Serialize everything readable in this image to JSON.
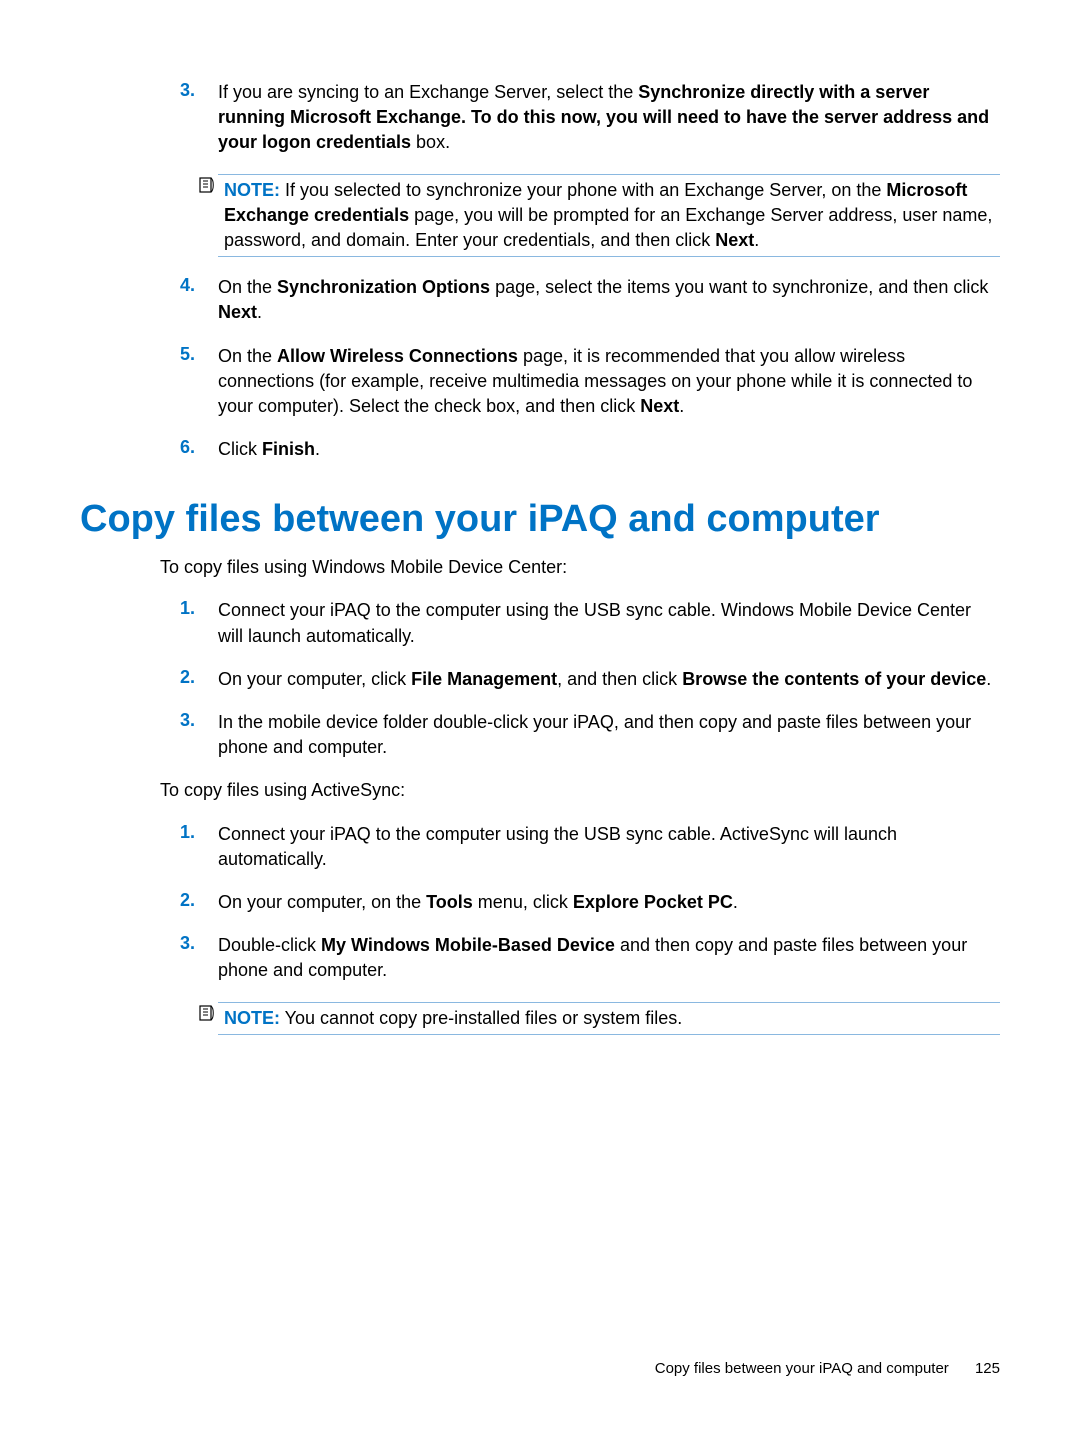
{
  "stepsA": {
    "s3": {
      "num": "3.",
      "t1": "If you are syncing to an Exchange Server, select the ",
      "b1": "Synchronize directly with a server running Microsoft Exchange. To do this now, you will need to have the server address and your logon credentials",
      "t2": " box."
    },
    "note3": {
      "label": "NOTE:",
      "t1": "   If you selected to synchronize your phone with an Exchange Server, on the ",
      "b1": "Microsoft Exchange credentials",
      "t2": " page, you will be prompted for an Exchange Server address, user name, password, and domain. Enter your credentials, and then click ",
      "b2": "Next",
      "t3": "."
    },
    "s4": {
      "num": "4.",
      "t1": "On the ",
      "b1": "Synchronization Options",
      "t2": " page, select the items you want to synchronize, and then click ",
      "b2": "Next",
      "t3": "."
    },
    "s5": {
      "num": "5.",
      "t1": "On the ",
      "b1": "Allow Wireless Connections",
      "t2": " page, it is recommended that you allow wireless connections (for example, receive multimedia messages on your phone while it is connected to your computer). Select the check box, and then click ",
      "b2": "Next",
      "t3": "."
    },
    "s6": {
      "num": "6.",
      "t1": "Click ",
      "b1": "Finish",
      "t2": "."
    }
  },
  "heading": "Copy files between your iPAQ and computer",
  "intro1": "To copy files using Windows Mobile Device Center:",
  "stepsB": {
    "s1": {
      "num": "1.",
      "t1": "Connect your iPAQ to the computer using the USB sync cable. Windows Mobile Device Center will launch automatically."
    },
    "s2": {
      "num": "2.",
      "t1": "On your computer, click ",
      "b1": "File Management",
      "t2": ", and then click ",
      "b2": "Browse the contents of your device",
      "t3": "."
    },
    "s3": {
      "num": "3.",
      "t1": "In the mobile device folder double-click your iPAQ, and then copy and paste files between your phone and computer."
    }
  },
  "intro2": "To copy files using ActiveSync:",
  "stepsC": {
    "s1": {
      "num": "1.",
      "t1": "Connect your iPAQ to the computer using the USB sync cable. ActiveSync will launch automatically."
    },
    "s2": {
      "num": "2.",
      "t1": "On your computer, on the ",
      "b1": "Tools",
      "t2": " menu, click ",
      "b2": "Explore Pocket PC",
      "t3": "."
    },
    "s3": {
      "num": "3.",
      "t1": "Double-click ",
      "b1": "My Windows Mobile-Based Device",
      "t2": " and then copy and paste files between your phone and computer."
    },
    "note": {
      "label": "NOTE:",
      "t1": "   You cannot copy pre-installed files or system files."
    }
  },
  "footer": {
    "text": "Copy files between your iPAQ and computer",
    "page": "125"
  }
}
